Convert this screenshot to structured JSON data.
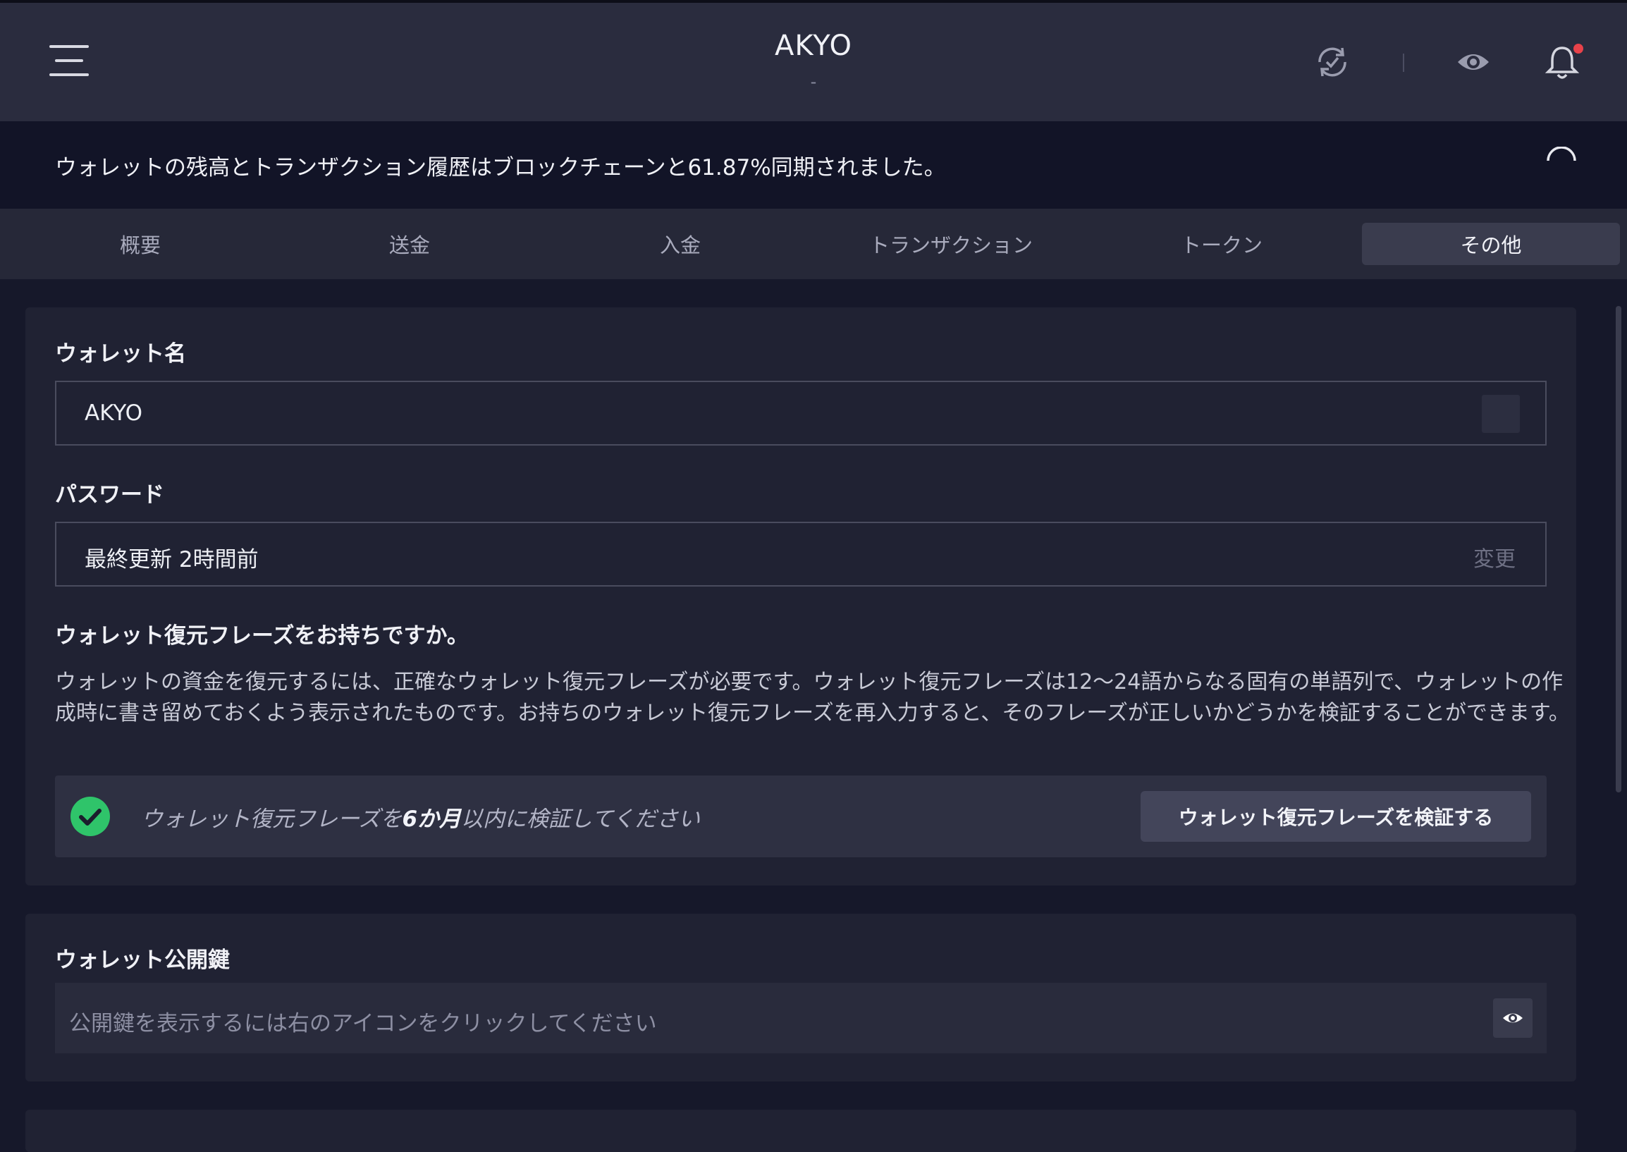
{
  "header": {
    "title": "AKYO",
    "subtitle": "-",
    "icons": [
      "menu-icon",
      "sync-check-icon",
      "eye-icon",
      "bell-icon"
    ],
    "notification_dot_color": "#e8424a"
  },
  "sync": {
    "message": "ウォレットの残高とトランザクション履歴はブロックチェーンと61.87%同期されました。",
    "percent": 61.87
  },
  "tabs": [
    {
      "label": "概要",
      "active": false
    },
    {
      "label": "送金",
      "active": false
    },
    {
      "label": "入金",
      "active": false
    },
    {
      "label": "トランザクション",
      "active": false
    },
    {
      "label": "トークン",
      "active": false
    },
    {
      "label": "その他",
      "active": true
    }
  ],
  "settings": {
    "wallet_name_label": "ウォレット名",
    "wallet_name_value": "AKYO",
    "password_label": "パスワード",
    "password_value": "最終更新 2時間前",
    "password_change": "変更",
    "recovery_heading": "ウォレット復元フレーズをお持ちですか。",
    "recovery_description": "ウォレットの資金を復元するには、正確なウォレット復元フレーズが必要です。ウォレット復元フレーズは12〜24語からなる固有の単語列で、ウォレットの作成時に書き留めておくよう表示されたものです。お持ちのウォレット復元フレーズを再入力すると、そのフレーズが正しいかどうかを検証することができます。",
    "notice_prefix": "ウォレット復元フレーズを",
    "notice_bold": "6か月",
    "notice_suffix": "以内に検証してください",
    "verify_button": "ウォレット復元フレーズを検証する"
  },
  "public_key": {
    "label": "ウォレット公開鍵",
    "placeholder": "公開鍵を表示するには右のアイコンをクリックしてください"
  },
  "colors": {
    "accent_green": "#2fc46a",
    "background": "#16182a"
  }
}
